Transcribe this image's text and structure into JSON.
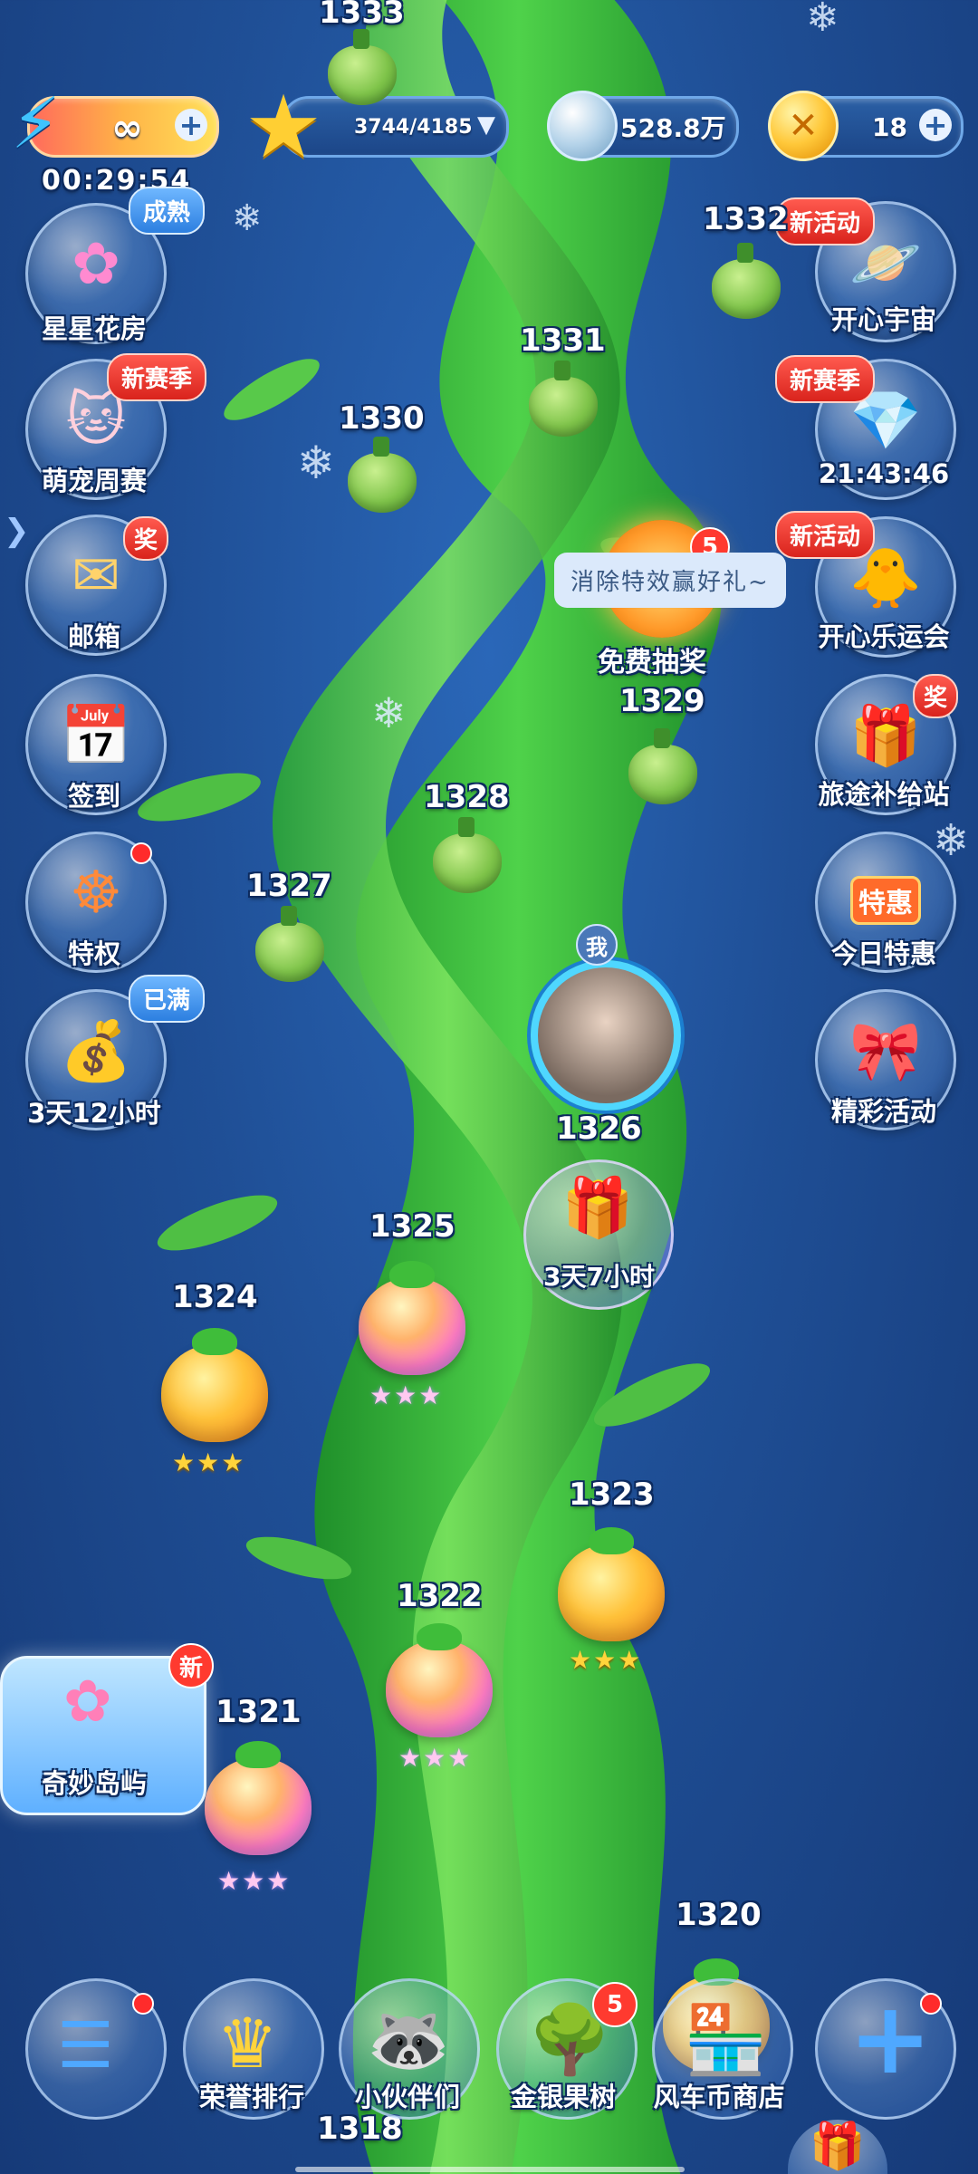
{
  "top_bar": {
    "energy": {
      "value": "∞",
      "timer": "00:29:54"
    },
    "stars": {
      "value": "3744/4185"
    },
    "coins": {
      "value": "528.8万"
    },
    "gold": {
      "value": "18"
    }
  },
  "left_menu": [
    {
      "label": "星星花房",
      "badge": "成熟"
    },
    {
      "label": "萌宠周赛",
      "badge": "新赛季"
    },
    {
      "label": "邮箱",
      "badge": "奖"
    },
    {
      "label": "签到"
    },
    {
      "label": "特权"
    },
    {
      "label": "3天12小时",
      "badge": "已满"
    }
  ],
  "right_menu": [
    {
      "label": "开心宇宙",
      "badge": "新活动"
    },
    {
      "label": "21:43:46",
      "badge": "新赛季"
    },
    {
      "label": "开心乐运会",
      "badge": "新活动"
    },
    {
      "label": "旅途补给站",
      "badge": "奖"
    },
    {
      "label": "今日特惠",
      "sign": "特惠"
    },
    {
      "label": "精彩活动"
    }
  ],
  "lottery": {
    "label": "免费抽奖",
    "tooltip": "消除特效赢好礼~",
    "count": "5"
  },
  "player": {
    "tag": "我",
    "level": "1326",
    "gift_timer": "3天7小时"
  },
  "island": {
    "label": "奇妙岛屿",
    "badge": "新"
  },
  "levels": {
    "l1333": "1333",
    "l1332": "1332",
    "l1331": "1331",
    "l1330": "1330",
    "l1329": "1329",
    "l1328": "1328",
    "l1327": "1327",
    "l1325": "1325",
    "l1324": "1324",
    "l1323": "1323",
    "l1322": "1322",
    "l1321": "1321",
    "l1320": "1320",
    "l1318": "1318"
  },
  "stars_glyph": "★★★",
  "bottom_nav": [
    {
      "label": ""
    },
    {
      "label": "荣誉排行"
    },
    {
      "label": "小伙伴们"
    },
    {
      "label": "金银果树",
      "count": "5"
    },
    {
      "label": "风车币商店"
    },
    {
      "label": ""
    }
  ],
  "colors": {
    "accent_red": "#ff3a2f",
    "star_gold": "#ffd43b",
    "stalk_green": "#35b83a"
  }
}
